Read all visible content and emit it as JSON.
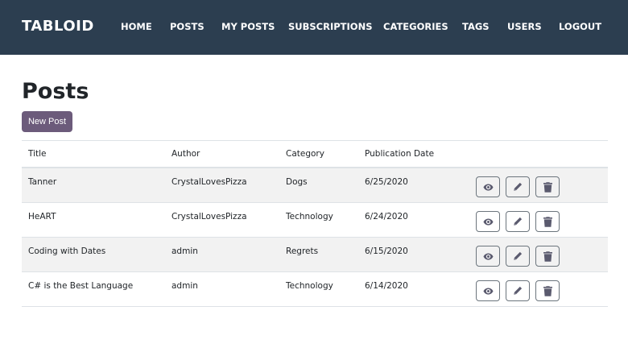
{
  "nav": {
    "brand": "TABLOID",
    "links": [
      "HOME",
      "POSTS",
      "MY POSTS",
      "SUBSCRIPTIONS",
      "CATEGORIES",
      "TAGS",
      "USERS",
      "LOGOUT"
    ]
  },
  "page": {
    "title": "Posts",
    "new_post_label": "New Post"
  },
  "table": {
    "headers": [
      "Title",
      "Author",
      "Category",
      "Publication Date"
    ],
    "rows": [
      {
        "title": "Tanner",
        "author": "CrystalLovesPizza",
        "category": "Dogs",
        "date": "6/25/2020"
      },
      {
        "title": "HeART",
        "author": "CrystalLovesPizza",
        "category": "Technology",
        "date": "6/24/2020"
      },
      {
        "title": "Coding with Dates",
        "author": "admin",
        "category": "Regrets",
        "date": "6/15/2020"
      },
      {
        "title": "C# is the Best Language",
        "author": "admin",
        "category": "Technology",
        "date": "6/14/2020"
      }
    ],
    "row_actions": [
      "eye-icon",
      "pencil-icon",
      "trash-icon"
    ]
  },
  "colors": {
    "navbar": "#2c3e50",
    "accent": "#6c5b7b",
    "row_stripe": "#f2f2f2"
  }
}
